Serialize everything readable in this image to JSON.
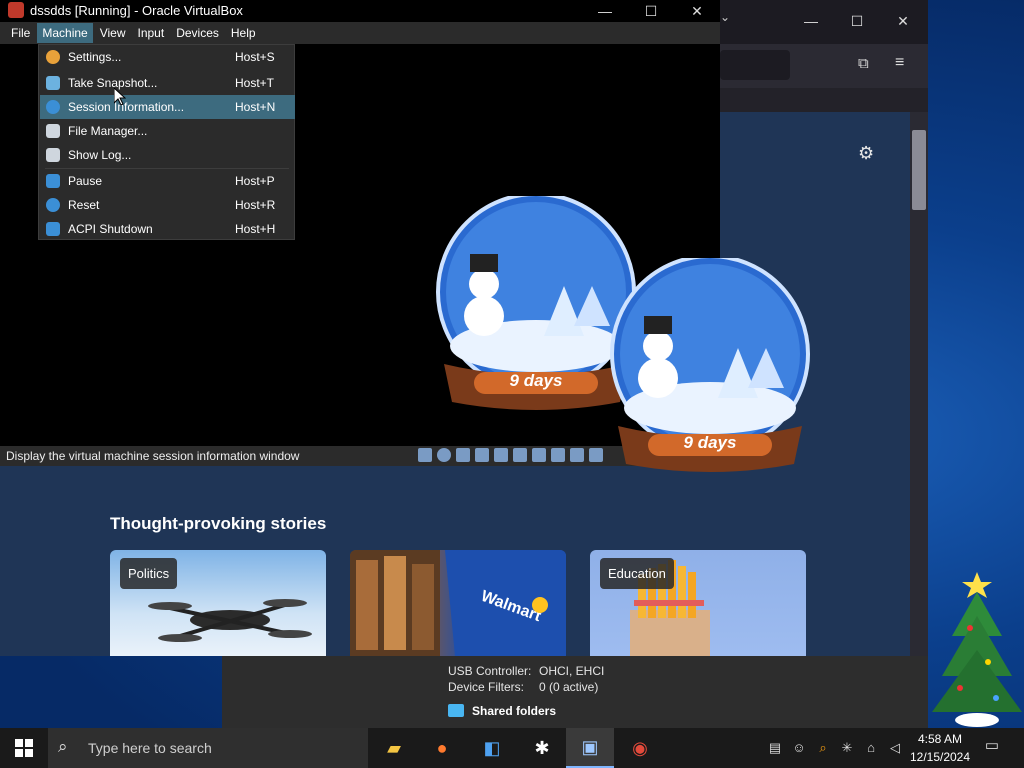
{
  "vbox": {
    "title": "dssdds [Running] - Oracle VirtualBox",
    "menubar": [
      "File",
      "Machine",
      "View",
      "Input",
      "Devices",
      "Help"
    ],
    "active_menu": "Machine",
    "status_text": "Display the virtual machine session information window",
    "machine_menu": [
      {
        "label": "Settings...",
        "shortcut": "Host+S",
        "icon": "gear-icon",
        "color": "#e8a13a"
      },
      {
        "label": "Take Snapshot...",
        "shortcut": "Host+T",
        "icon": "camera-icon",
        "color": "#6cb2e0"
      },
      {
        "label": "Session Information...",
        "shortcut": "Host+N",
        "icon": "info-icon",
        "color": "#3b8fd6",
        "selected": true
      },
      {
        "label": "File Manager...",
        "shortcut": "",
        "icon": "file-manager-icon",
        "color": "#cfd6de"
      },
      {
        "label": "Show Log...",
        "shortcut": "",
        "icon": "log-icon",
        "color": "#cfd6de"
      },
      {
        "label": "Pause",
        "shortcut": "Host+P",
        "icon": "pause-icon",
        "color": "#3b8fd6"
      },
      {
        "label": "Reset",
        "shortcut": "Host+R",
        "icon": "reset-icon",
        "color": "#3b8fd6"
      },
      {
        "label": "ACPI Shutdown",
        "shortcut": "Host+H",
        "icon": "power-icon",
        "color": "#3b8fd6"
      }
    ]
  },
  "browser": {
    "section_title": "Thought-provoking stories",
    "cards": [
      {
        "tag": "Politics"
      },
      {
        "tag": ""
      },
      {
        "tag": "Education"
      }
    ]
  },
  "vm_details": {
    "usb_label": "USB Controller:",
    "usb_value": "OHCI, EHCI",
    "filters_label": "Device Filters:",
    "filters_value": "0 (0 active)",
    "shared_folders": "Shared folders"
  },
  "globes": [
    {
      "text": "9 days"
    },
    {
      "text": "9 days"
    }
  ],
  "taskbar": {
    "search_placeholder": "Type here to search",
    "time": "4:58 AM",
    "date": "12/15/2024",
    "apps": [
      "file-explorer-icon",
      "firefox-icon",
      "visual-studio-icon",
      "snipping-icon",
      "virtualbox-manager-icon",
      "virtualbox-icon"
    ]
  }
}
